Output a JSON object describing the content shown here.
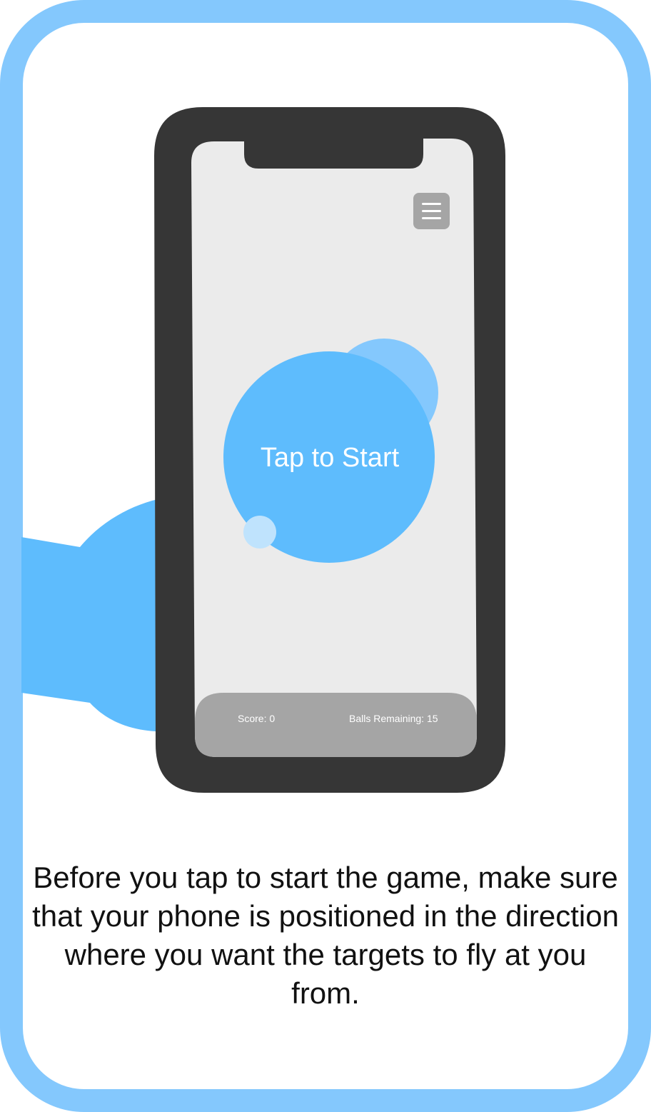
{
  "game": {
    "start_label": "Tap to Start",
    "score_text": "Score: 0",
    "balls_remaining_text": "Balls Remaining: 15",
    "menu_icon": "hamburger-menu-icon"
  },
  "instruction": {
    "text": "Before you tap to start the game, make sure that your phone is positioned in the direction where you want the targets to fly at you from."
  },
  "colors": {
    "frame_border": "#84c8fd",
    "hand": "#5ebcfd",
    "start_circle": "#5ebcfd",
    "back_target": "#84c8fd",
    "small_target": "#bfe3fd",
    "phone_body": "#363636",
    "screen": "#ebebeb",
    "status_bar": "#a5a5a5",
    "menu_button": "#a5a5a5"
  }
}
